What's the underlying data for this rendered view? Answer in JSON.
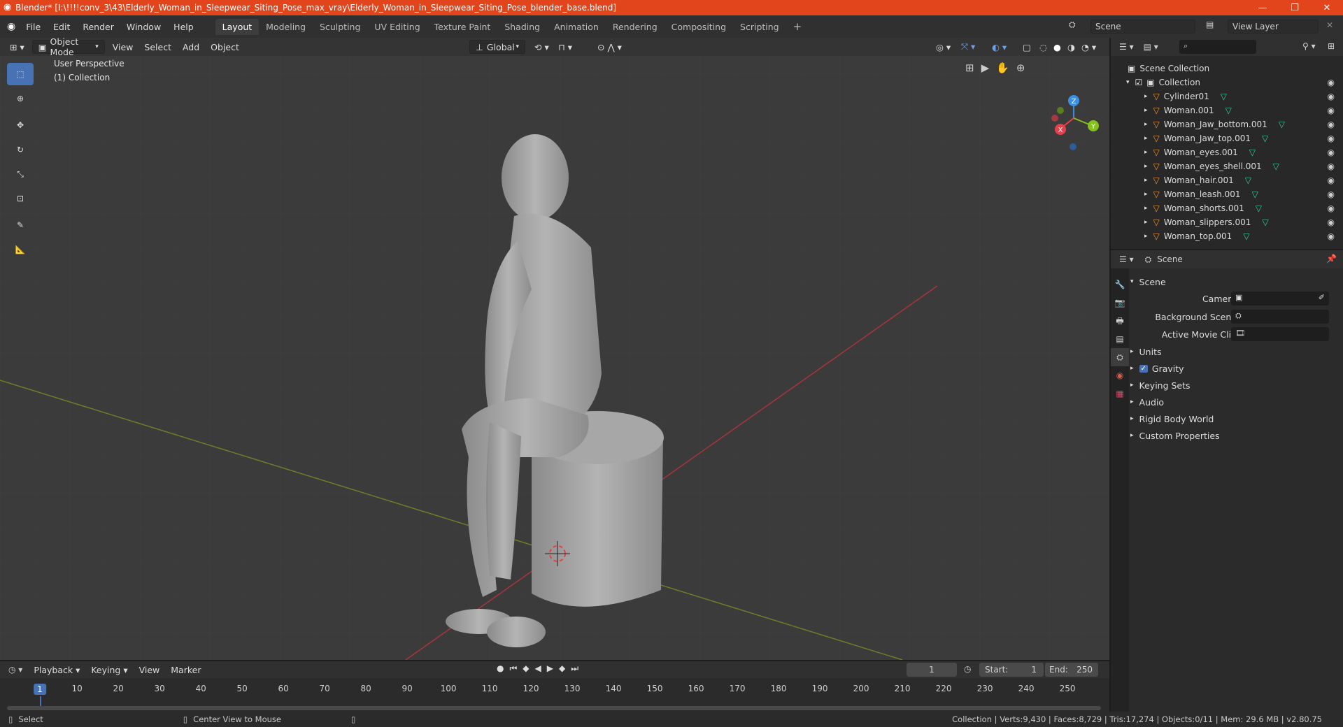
{
  "window": {
    "title": "Blender* [I:\\!!!!conv_3\\43\\Elderly_Woman_in_Sleepwear_Siting_Pose_max_vray\\Elderly_Woman_in_Sleepwear_Siting_Pose_blender_base.blend]",
    "accent": "#e2451c"
  },
  "menubar": {
    "menus": [
      "File",
      "Edit",
      "Render",
      "Window",
      "Help"
    ],
    "workspaces": [
      "Layout",
      "Modeling",
      "Sculpting",
      "UV Editing",
      "Texture Paint",
      "Shading",
      "Animation",
      "Rendering",
      "Compositing",
      "Scripting"
    ],
    "active_workspace": "Layout",
    "add_tab": "+",
    "scene_label": "Scene",
    "view_layer_label": "View Layer"
  },
  "viewport": {
    "mode": "Object Mode",
    "menus": [
      "View",
      "Select",
      "Add",
      "Object"
    ],
    "orientation": "Global",
    "overlay_title": "User Perspective",
    "overlay_collection": "(1) Collection",
    "gizmo_axes": [
      "X",
      "Y",
      "Z"
    ]
  },
  "outliner": {
    "search_placeholder": "",
    "scene_collection": "Scene Collection",
    "collection": "Collection",
    "objects": [
      "Cylinder01",
      "Woman.001",
      "Woman_Jaw_bottom.001",
      "Woman_Jaw_top.001",
      "Woman_eyes.001",
      "Woman_eyes_shell.001",
      "Woman_hair.001",
      "Woman_leash.001",
      "Woman_shorts.001",
      "Woman_slippers.001",
      "Woman_top.001"
    ]
  },
  "properties": {
    "context_label": "Scene",
    "panel_title": "Scene",
    "fields": {
      "camera": "Camera",
      "background_scene": "Background Scene",
      "active_movie_clip": "Active Movie Clip"
    },
    "sections": [
      "Units",
      "Gravity",
      "Keying Sets",
      "Audio",
      "Rigid Body World",
      "Custom Properties"
    ],
    "gravity_checked": true
  },
  "timeline": {
    "menus": [
      "Playback",
      "Keying",
      "View",
      "Marker"
    ],
    "current_frame": "1",
    "start_label": "Start:",
    "start": "1",
    "end_label": "End:",
    "end": "250",
    "ticks": [
      "1",
      "10",
      "20",
      "30",
      "40",
      "50",
      "60",
      "70",
      "80",
      "90",
      "100",
      "110",
      "120",
      "130",
      "140",
      "150",
      "160",
      "170",
      "180",
      "190",
      "200",
      "210",
      "220",
      "230",
      "240",
      "250"
    ]
  },
  "statusbar": {
    "select": "Select",
    "center_view": "Center View to Mouse",
    "stats": "Collection | Verts:9,430 | Faces:8,729 | Tris:17,274 | Objects:0/11 | Mem: 29.6 MB | v2.80.75"
  },
  "colors": {
    "active_blue": "#4772b3",
    "axis_x": "#e8404a",
    "axis_y": "#86c21e",
    "axis_z": "#3d8ee0",
    "mesh_icon": "#3ec9a0",
    "object_icon": "#e8923c"
  }
}
